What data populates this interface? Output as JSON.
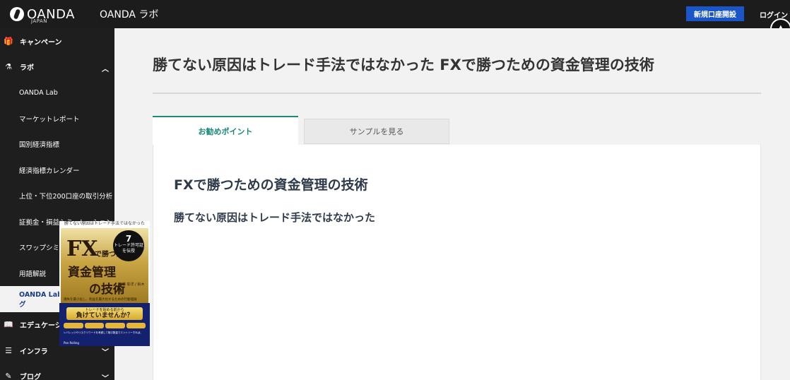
{
  "header": {
    "logo_text": "OANDA",
    "logo_sub": "JAPAN",
    "site_name": "OANDA ラボ",
    "open_account_label": "新規口座開設",
    "login_label": "ログイン"
  },
  "sidebar": {
    "items": [
      {
        "label": "キャンペーン",
        "icon": "gift-icon"
      },
      {
        "label": "ラボ",
        "icon": "flask-icon"
      },
      {
        "label": "OANDA Lab"
      },
      {
        "label": "マーケットレポート"
      },
      {
        "label": "国別経済指標"
      },
      {
        "label": "経済指標カレンダー"
      },
      {
        "label": "上位・下位200口座の取引分析"
      },
      {
        "label": "証拠金・損益シミュレーション"
      },
      {
        "label": "スワップシミュレーション"
      },
      {
        "label": "用語解説"
      },
      {
        "label": "OANDA Lab×パンローリング"
      },
      {
        "label": "エデュケーション",
        "icon": "book-icon"
      },
      {
        "label": "インフラ",
        "icon": "server-icon"
      },
      {
        "label": "ブログ",
        "icon": "pencil-icon"
      }
    ]
  },
  "main": {
    "title": "勝てない原因はトレード手法ではなかった FXで勝つための資金管理の技術",
    "tabs": [
      {
        "label": "お勧めポイント"
      },
      {
        "label": "サンプルを見る"
      }
    ],
    "heading": "FXで勝つための資金管理の技術",
    "subheading": "勝てない原因はトレード手法ではなかった"
  },
  "book_cover": {
    "top_text": "勝てない原因はトレード手法ではなかった",
    "fx": "FX",
    "sub1": "で勝つための",
    "title_line1": "資金管理",
    "title_line2": "の技術",
    "badge_num": "7",
    "badge_text": "トレード許可証を伝授",
    "authors": "伊藤 彰洋 / 鈴木 健",
    "tagline": "損失を最小化し、利益を最大化するための行動理論",
    "banner_small": "トレードを始める前から",
    "banner_big": "負けていませんか？",
    "body": "レバレッジやリスクリワードを考慮して取引数量でエントリーすれば、",
    "publisher": "Pan Rolling"
  },
  "colors": {
    "header_bg": "#1c1c1c",
    "sidebar_bg": "#1e1e1e",
    "accent_blue": "#1a56c9",
    "tab_accent": "#1a8a7a"
  }
}
